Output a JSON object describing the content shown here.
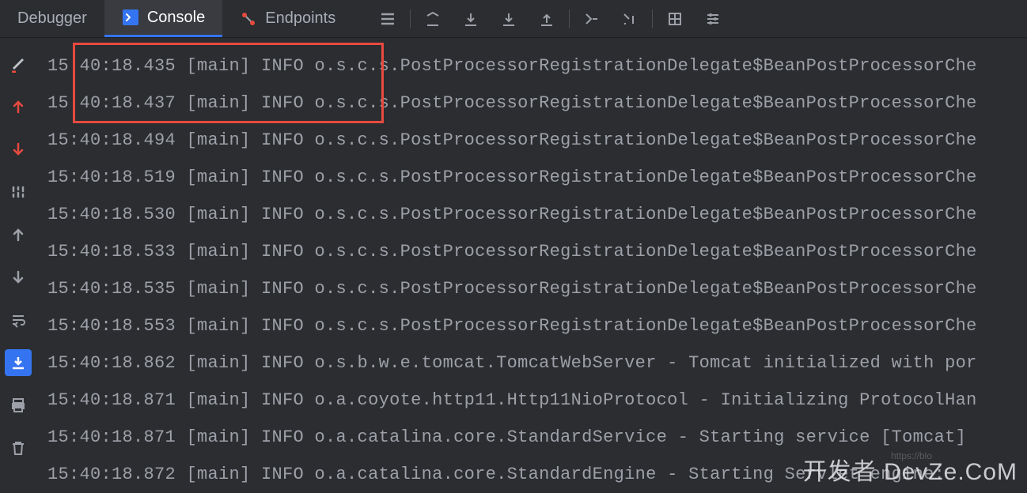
{
  "tabs": {
    "debugger": "Debugger",
    "console": "Console",
    "endpoints": "Endpoints"
  },
  "logs": [
    {
      "time": "15:40:18.435",
      "thread": "[main]",
      "level": "INFO",
      "msg": "o.s.c.s.PostProcessorRegistrationDelegate$BeanPostProcessorChe"
    },
    {
      "time": "15:40:18.437",
      "thread": "[main]",
      "level": "INFO",
      "msg": "o.s.c.s.PostProcessorRegistrationDelegate$BeanPostProcessorChe"
    },
    {
      "time": "15:40:18.494",
      "thread": "[main]",
      "level": "INFO",
      "msg": "o.s.c.s.PostProcessorRegistrationDelegate$BeanPostProcessorChe"
    },
    {
      "time": "15:40:18.519",
      "thread": "[main]",
      "level": "INFO",
      "msg": "o.s.c.s.PostProcessorRegistrationDelegate$BeanPostProcessorChe"
    },
    {
      "time": "15:40:18.530",
      "thread": "[main]",
      "level": "INFO",
      "msg": "o.s.c.s.PostProcessorRegistrationDelegate$BeanPostProcessorChe"
    },
    {
      "time": "15:40:18.533",
      "thread": "[main]",
      "level": "INFO",
      "msg": "o.s.c.s.PostProcessorRegistrationDelegate$BeanPostProcessorChe"
    },
    {
      "time": "15:40:18.535",
      "thread": "[main]",
      "level": "INFO",
      "msg": "o.s.c.s.PostProcessorRegistrationDelegate$BeanPostProcessorChe"
    },
    {
      "time": "15:40:18.553",
      "thread": "[main]",
      "level": "INFO",
      "msg": "o.s.c.s.PostProcessorRegistrationDelegate$BeanPostProcessorChe"
    },
    {
      "time": "15:40:18.862",
      "thread": "[main]",
      "level": "INFO",
      "msg": "o.s.b.w.e.tomcat.TomcatWebServer - Tomcat initialized with por"
    },
    {
      "time": "15:40:18.871",
      "thread": "[main]",
      "level": "INFO",
      "msg": "o.a.coyote.http11.Http11NioProtocol - Initializing ProtocolHan"
    },
    {
      "time": "15:40:18.871",
      "thread": "[main]",
      "level": "INFO",
      "msg": "o.a.catalina.core.StandardService - Starting service [Tomcat]"
    },
    {
      "time": "15:40:18.872",
      "thread": "[main]",
      "level": "INFO",
      "msg": "o.a.catalina.core.StandardEngine - Starting Servlet engine:"
    }
  ],
  "watermark": "开发者 DevZe.CoM",
  "watermark_url": "https://blo"
}
